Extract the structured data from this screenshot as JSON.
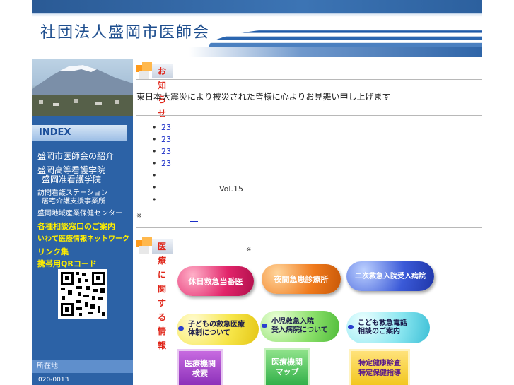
{
  "header": {
    "title": "社団法人盛岡市医師会"
  },
  "sidebar": {
    "index_label": "INDEX",
    "items": [
      {
        "label": "盛岡市医師会の紹介"
      },
      {
        "label": "盛岡高等看護学院"
      },
      {
        "label": "盛岡准看護学院"
      },
      {
        "label": "訪問看護ステーション"
      },
      {
        "label": "居宅介護支援事業所"
      },
      {
        "label": "盛岡地域産業保健センター"
      },
      {
        "label": "各種相談窓口のご案内"
      },
      {
        "label": "いわて医療情報ネットワーク"
      },
      {
        "label": "リンク集"
      },
      {
        "label": "携帯用QRコード"
      }
    ],
    "address_label": "所在地",
    "postal": "020-0013"
  },
  "news_section": {
    "heading": "お知らせ",
    "notice": "東日本大震災により被災された皆様に心よりお見舞い申し上げます",
    "items": [
      {
        "link": "23",
        "suffix": ""
      },
      {
        "link": "23",
        "suffix": ""
      },
      {
        "link": "23",
        "suffix": ""
      },
      {
        "link": "23",
        "suffix": ""
      },
      {
        "link": "",
        "suffix": ""
      },
      {
        "link": "",
        "suffix": "Vol.15"
      },
      {
        "link": "",
        "suffix": ""
      }
    ],
    "note_mark": "※"
  },
  "medical_section": {
    "heading": "医療に関する情報",
    "note_mark": "※"
  },
  "buttons": {
    "holiday": "休日救急当番医",
    "night": "夜間急患診療所",
    "secondary": "二次救急入院受入病院",
    "child_system_line1": "子どもの救急医療",
    "child_system_line2": "体制について",
    "pediatric_line1": "小児救急入院",
    "pediatric_line2": "受入病院について",
    "phone_line1": "こども救急電話",
    "phone_line2": "相談のご案内",
    "search_line1": "医療機関",
    "search_line2": "検索",
    "map_line1": "医療機関",
    "map_line2": "マップ",
    "checkup_line1": "特定健康診査",
    "checkup_line2": "特定保健指導"
  }
}
